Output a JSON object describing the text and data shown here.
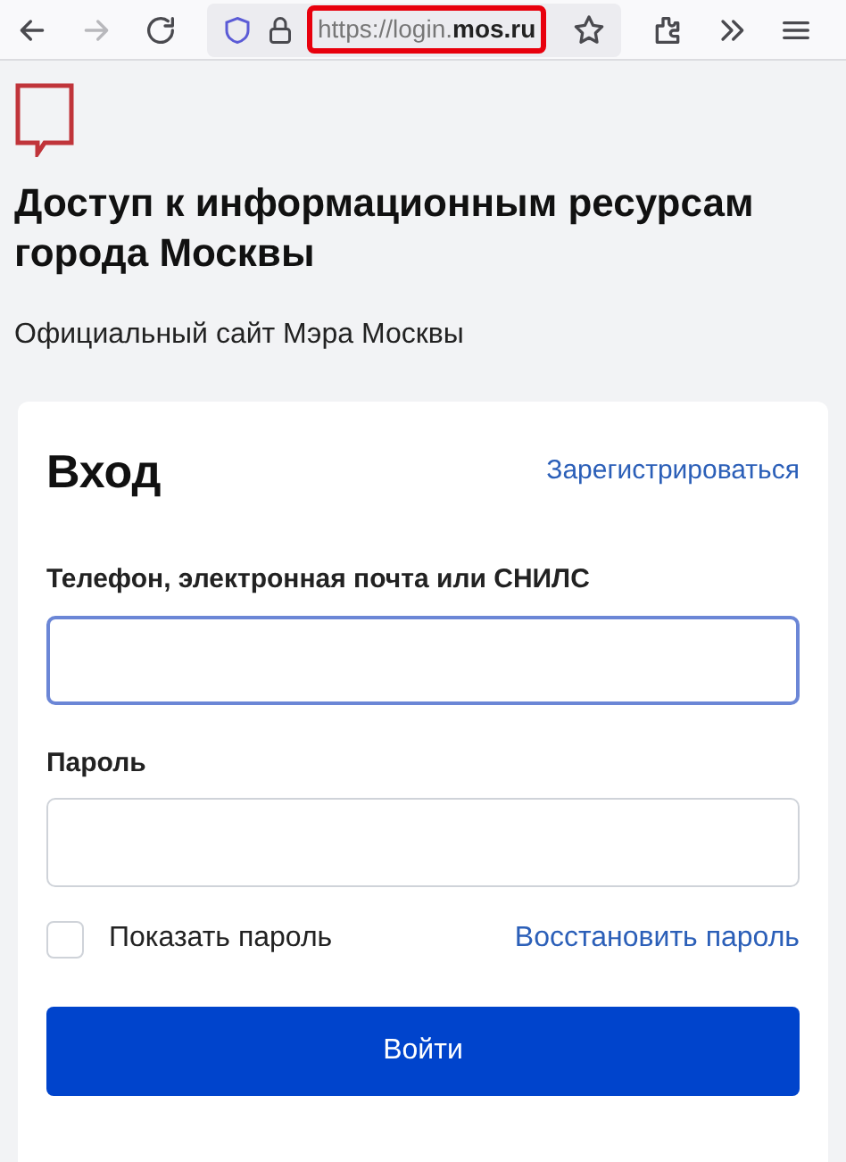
{
  "browser": {
    "url": "https://login.**mos.ru**",
    "url_highlighted": true
  },
  "page": {
    "title": "Доступ к информационным ресурсам города Москвы",
    "subtitle": "Официальный сайт Мэра Москвы"
  },
  "form": {
    "title": "Вход",
    "register_link": "Зарегистрироваться",
    "fields": [
      {
        "label": "Телефон, электронная почта или СНИЛС",
        "focused": true
      },
      {
        "label": "Пароль",
        "focused": false
      }
    ],
    "show_password": {
      "label": "Показать пароль",
      "checked": false
    },
    "recover_link": "Восстановить пароль",
    "submit": "Войти"
  }
}
